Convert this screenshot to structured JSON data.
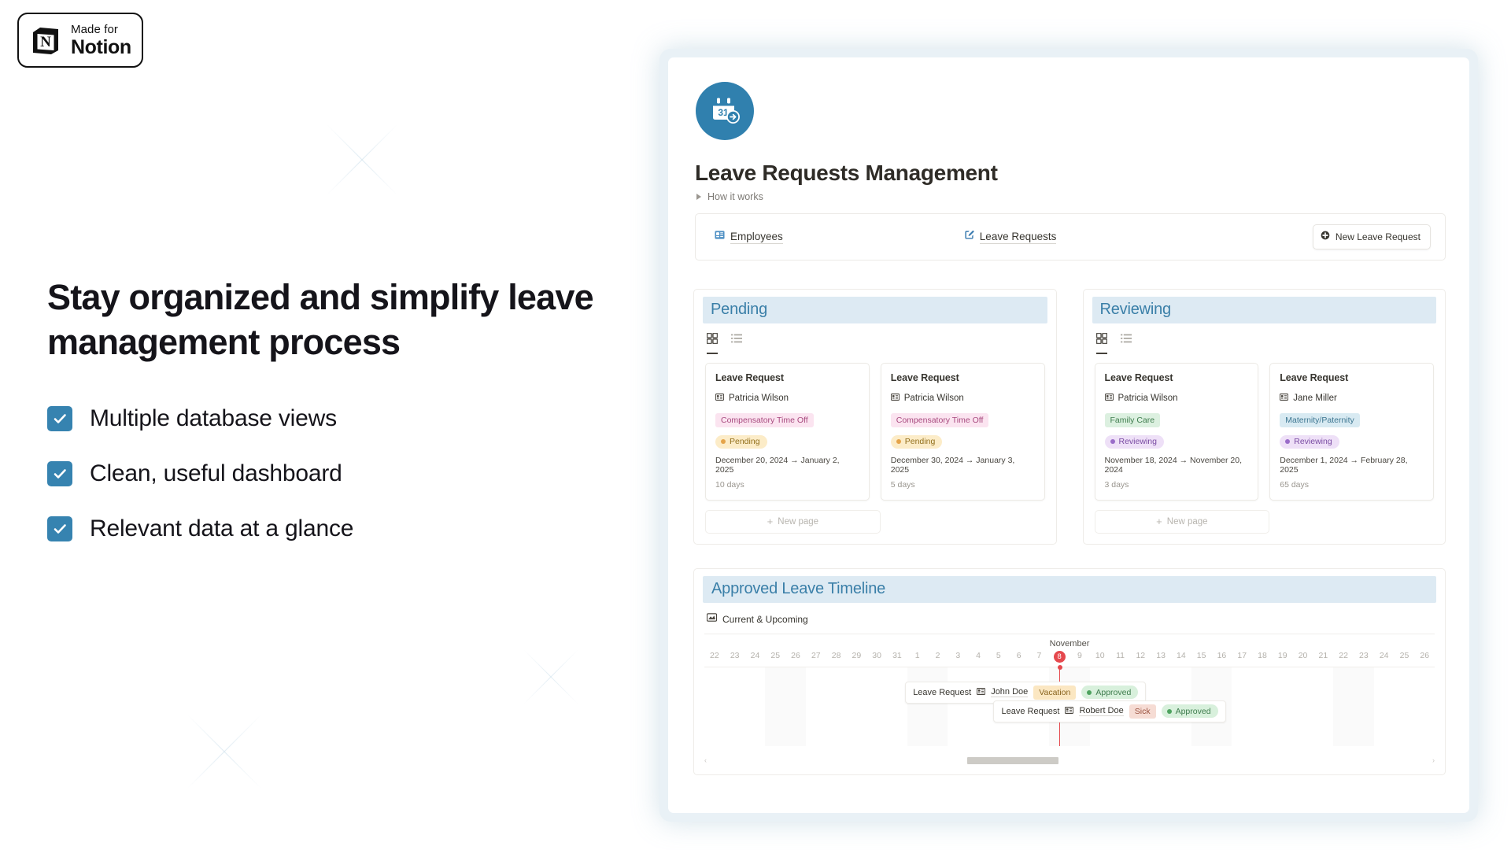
{
  "badge": {
    "made_for": "Made for",
    "brand": "Notion",
    "icon": "notion-cube-icon"
  },
  "marketing": {
    "headline": "Stay organized and simplify leave management process",
    "features": [
      {
        "label": "Multiple database views",
        "checked": true
      },
      {
        "label": "Clean, useful dashboard",
        "checked": true
      },
      {
        "label": "Relevant data at a glance",
        "checked": true
      }
    ],
    "accent": "#3683b0"
  },
  "app": {
    "page_icon": "calendar-31-arrow-icon",
    "page_icon_bg": "#3080ae",
    "title": "Leave Requests Management",
    "toggle": {
      "label": "How it works",
      "icon": "triangle-right-icon"
    },
    "nav": {
      "links": [
        {
          "label": "Employees",
          "icon": "contact-card-icon"
        },
        {
          "label": "Leave Requests",
          "icon": "edit-square-icon"
        }
      ],
      "new_button": {
        "label": "New Leave Request",
        "icon": "plus-circle-icon"
      }
    },
    "boards": [
      {
        "title": "Pending",
        "title_color": "#3a7fa8",
        "header_bg": "#ddeaf3",
        "views": [
          {
            "icon": "gallery-grid-icon",
            "active": true
          },
          {
            "icon": "list-icon",
            "active": false
          }
        ],
        "new_page_label": "New page",
        "cards": [
          {
            "title": "Leave Request",
            "person": "Patricia Wilson",
            "type": "Compensatory Time Off",
            "type_bg": "#fbe4f0",
            "type_fg": "#a84a7f",
            "status": "Pending",
            "status_bg": "#fcecc8",
            "status_fg": "#93701d",
            "status_dot": "#e5a44a",
            "dates": "December 20, 2024 → January 2, 2025",
            "days": "10 days"
          },
          {
            "title": "Leave Request",
            "person": "Patricia Wilson",
            "type": "Compensatory Time Off",
            "type_bg": "#fbe4f0",
            "type_fg": "#a84a7f",
            "status": "Pending",
            "status_bg": "#fcecc8",
            "status_fg": "#93701d",
            "status_dot": "#e5a44a",
            "dates": "December 30, 2024 → January 3, 2025",
            "days": "5 days"
          }
        ]
      },
      {
        "title": "Reviewing",
        "title_color": "#3a7fa8",
        "header_bg": "#ddeaf3",
        "views": [
          {
            "icon": "gallery-grid-icon",
            "active": true
          },
          {
            "icon": "list-icon",
            "active": false
          }
        ],
        "new_page_label": "New page",
        "cards": [
          {
            "title": "Leave Request",
            "person": "Patricia Wilson",
            "type": "Family Care",
            "type_bg": "#dcf0e0",
            "type_fg": "#3f7d4e",
            "status": "Reviewing",
            "status_bg": "#eee0f7",
            "status_fg": "#7a4ba3",
            "status_dot": "#9a6cc9",
            "dates": "November 18, 2024 → November 20, 2024",
            "days": "3 days"
          },
          {
            "title": "Leave Request",
            "person": "Jane Miller",
            "type": "Maternity/Paternity",
            "type_bg": "#d8eaf2",
            "type_fg": "#3d7691",
            "status": "Reviewing",
            "status_bg": "#eee0f7",
            "status_fg": "#7a4ba3",
            "status_dot": "#9a6cc9",
            "dates": "December 1, 2024 → February 28, 2025",
            "days": "65 days"
          }
        ]
      }
    ],
    "timeline": {
      "title": "Approved Leave Timeline",
      "title_color": "#3a7fa8",
      "header_bg": "#ddeaf3",
      "view": {
        "label": "Current & Upcoming",
        "icon": "timeline-view-icon"
      },
      "month_label": "November",
      "today": "8",
      "days": [
        "22",
        "23",
        "24",
        "25",
        "26",
        "27",
        "28",
        "29",
        "30",
        "31",
        "1",
        "2",
        "3",
        "4",
        "5",
        "6",
        "7",
        "8",
        "9",
        "10",
        "11",
        "12",
        "13",
        "14",
        "15",
        "16",
        "17",
        "18",
        "19",
        "20",
        "21",
        "22",
        "23",
        "24",
        "25",
        "26"
      ],
      "marker_color": "#e5484d",
      "bars": [
        {
          "label": "Leave Request",
          "person": "John Doe",
          "type": "Vacation",
          "type_bg": "#fbe7c2",
          "type_fg": "#8a6520",
          "status": "Approved",
          "status_bg": "#d8f0dc",
          "status_fg": "#3f7d4e",
          "status_dot": "#4ea35f",
          "icon": "contact-card-icon"
        },
        {
          "label": "Leave Request",
          "person": "Robert Doe",
          "type": "Sick",
          "type_bg": "#f6dcd4",
          "type_fg": "#9b5340",
          "status": "Approved",
          "status_bg": "#d8f0dc",
          "status_fg": "#3f7d4e",
          "status_dot": "#4ea35f",
          "icon": "contact-card-icon"
        }
      ],
      "scroll": {
        "left_arrow": "‹",
        "right_arrow": "›"
      }
    }
  }
}
